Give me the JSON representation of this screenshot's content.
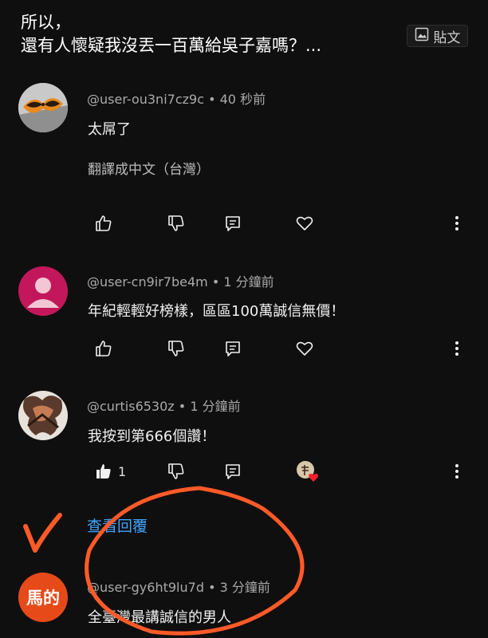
{
  "header": {
    "title_line1": "所以，",
    "title_line2": "還有人懷疑我沒丟一百萬給吳子嘉嗎？...",
    "paste_label": "貼文"
  },
  "comments": [
    {
      "handle": "@user-ou3ni7cz9c",
      "time": "40 秒前",
      "text": "太屌了",
      "translate": "翻譯成中文（台灣）",
      "likes": ""
    },
    {
      "handle": "@user-cn9ir7be4m",
      "time": "1 分鐘前",
      "text": "年紀輕輕好榜樣，區區100萬誠信無價！",
      "likes": ""
    },
    {
      "handle": "@curtis6530z",
      "time": "1 分鐘前",
      "text": "我按到第666個讚！",
      "likes": "1"
    },
    {
      "handle": "@user-gy6ht9lu7d",
      "time": "3 分鐘前",
      "text": "全臺灣最講誠信的男人",
      "avatar_text": "馬的"
    }
  ],
  "view_replies": "查看回覆",
  "colors": {
    "background": "#0f0f0f",
    "link": "#3ea6ff",
    "annotation": "#ff5a28",
    "avatar_pink": "#c2185b",
    "avatar_orange": "#e64a19"
  },
  "icons": [
    "image-icon",
    "thumb-up-icon",
    "thumb-down-icon",
    "reply-icon",
    "heart-icon",
    "more-vert-icon",
    "creator-heart-icon",
    "checkmark-annotation",
    "circle-annotation"
  ]
}
